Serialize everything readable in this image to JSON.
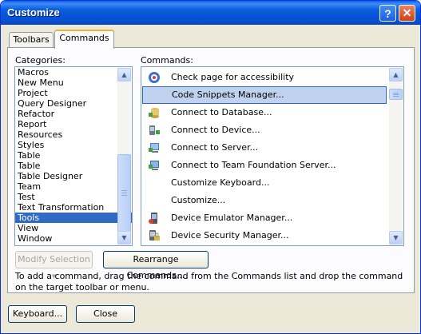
{
  "window": {
    "title": "Customize",
    "help_button": "?",
    "close_button": "✕"
  },
  "tabs": [
    {
      "label": "Toolbars",
      "selected": false
    },
    {
      "label": "Commands",
      "selected": true
    }
  ],
  "categories": {
    "label": "Categories:",
    "items": [
      "Macros",
      "New Menu",
      "Project",
      "Query Designer",
      "Refactor",
      "Report",
      "Resources",
      "Styles",
      "Table",
      "Table",
      "Table Designer",
      "Team",
      "Test",
      "Text Transformation",
      "Tools",
      "View",
      "Window"
    ],
    "selected": "Tools"
  },
  "commands": {
    "label": "Commands:",
    "items": [
      {
        "label": "Check page for accessibility",
        "icon": "accessibility-check-icon"
      },
      {
        "label": "Code Snippets Manager...",
        "icon": "none",
        "selected": true
      },
      {
        "label": "Connect to Database...",
        "icon": "connect-database-icon"
      },
      {
        "label": "Connect to Device...",
        "icon": "connect-device-icon"
      },
      {
        "label": "Connect to Server...",
        "icon": "connect-server-icon"
      },
      {
        "label": "Connect to Team Foundation Server...",
        "icon": "connect-tfs-icon"
      },
      {
        "label": "Customize Keyboard...",
        "icon": "none"
      },
      {
        "label": "Customize...",
        "icon": "none"
      },
      {
        "label": "Device Emulator Manager...",
        "icon": "device-emulator-icon"
      },
      {
        "label": "Device Security Manager...",
        "icon": "device-security-icon"
      }
    ]
  },
  "buttons": {
    "modify_selection": "Modify Selection",
    "rearrange_commands": "Rearrange Commands...",
    "keyboard": "Keyboard...",
    "close": "Close"
  },
  "hint": "To add a command, drag the command from the Commands list and drop the command on the target toolbar or menu.",
  "colors": {
    "titlebar": "#0a4fd0",
    "selection": "#316ac5",
    "dialog_bg": "#ece9d8"
  }
}
